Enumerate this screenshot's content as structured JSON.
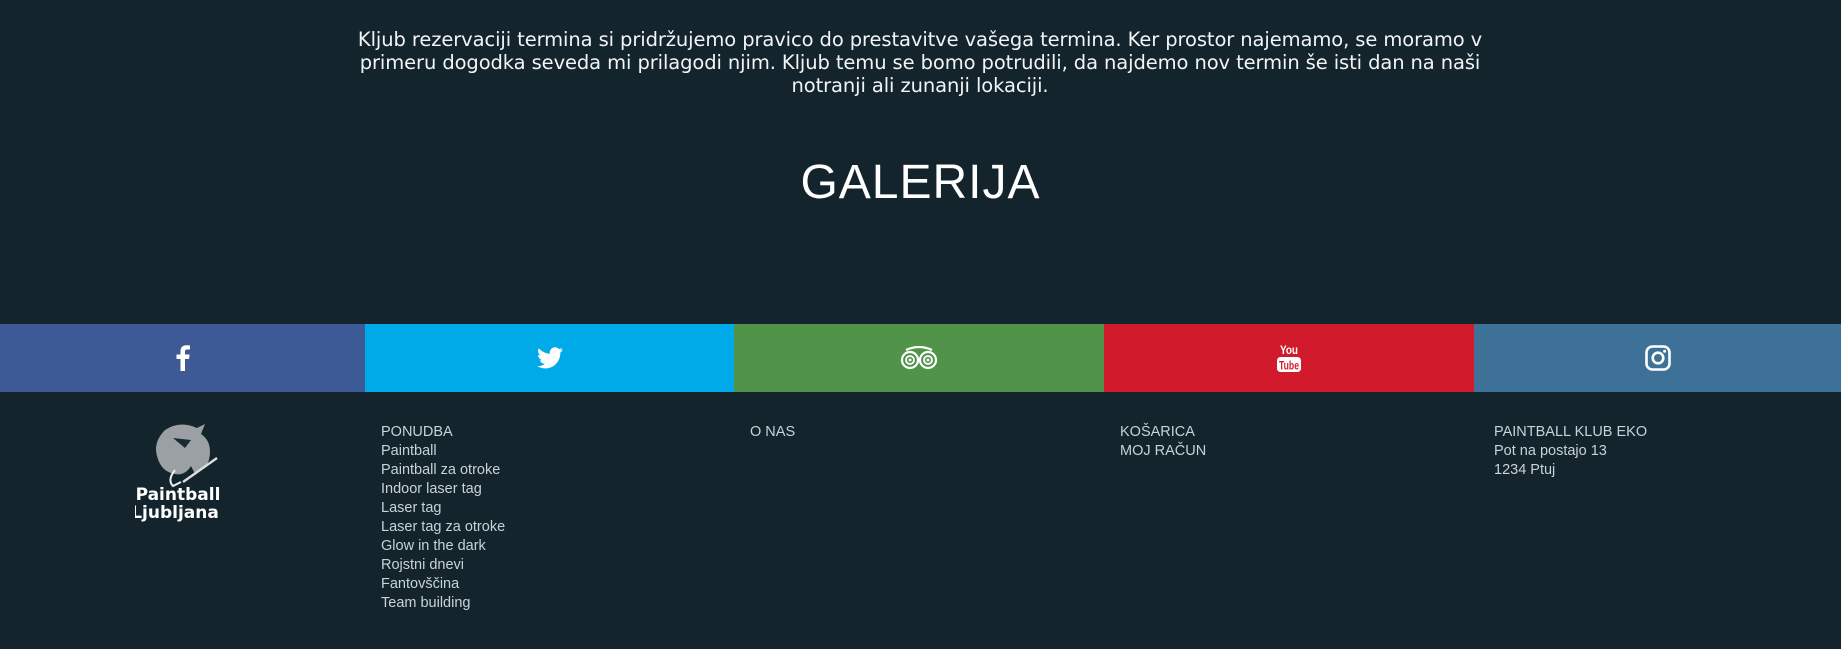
{
  "notice": {
    "text": "Kljub rezervaciji termina si pridržujemo pravico do prestavitve vašega termina. Ker prostor najemamo, se moramo v primeru dogodka seveda mi prilagodi njim. Kljub temu se bomo potrudili, da najdemo nov termin še isti dan na naši notranji ali zunanji lokaciji."
  },
  "gallery": {
    "title": "GALERIJA"
  },
  "social": [
    {
      "name": "Facebook",
      "icon": "facebook-icon",
      "color": "#3d5996"
    },
    {
      "name": "Twitter",
      "icon": "twitter-icon",
      "color": "#00aae8"
    },
    {
      "name": "TripAdvisor",
      "icon": "tripadvisor-icon",
      "color": "#519449"
    },
    {
      "name": "YouTube",
      "icon": "youtube-icon",
      "color": "#d11a2c"
    },
    {
      "name": "Instagram",
      "icon": "instagram-icon",
      "color": "#3e7198"
    }
  ],
  "footer": {
    "logo": {
      "line1": "Paintball",
      "line2": "Ljubljana"
    },
    "ponudba": {
      "heading": "PONUDBA",
      "items": [
        "Paintball",
        "Paintball za otroke",
        "Indoor laser tag",
        "Laser tag",
        "Laser tag za otroke",
        "Glow in the dark",
        "Rojstni dnevi",
        "Fantovščina",
        "Team building"
      ]
    },
    "onas": {
      "heading": "O NAS"
    },
    "kosarica": {
      "heading": "KOŠARICA",
      "items": [
        "MOJ RAČUN"
      ]
    },
    "klub": {
      "heading": "PAINTBALL KLUB EKO",
      "lines": [
        "Pot na postajo 13",
        "1234 Ptuj"
      ]
    }
  },
  "colors": {
    "background": "#13242d",
    "footer_text": "#c9d2d7"
  }
}
